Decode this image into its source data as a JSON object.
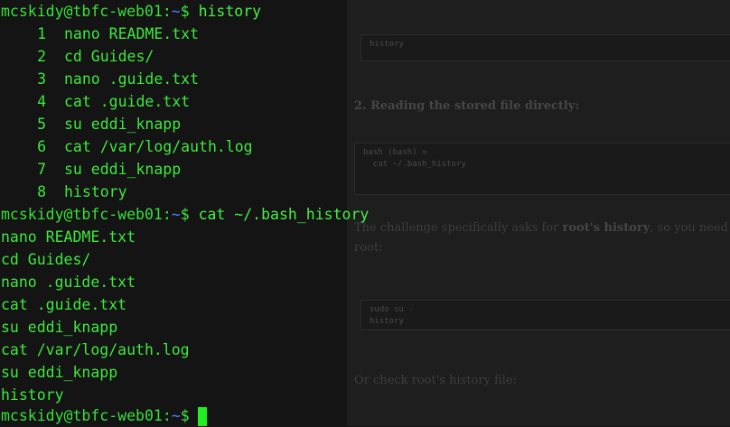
{
  "terminal": {
    "prompt": {
      "user_host": "mcskidy@tbfc-web01",
      "separator": ":",
      "path": "~",
      "symbol": "$"
    },
    "commands": {
      "first": "history",
      "second": "cat ~/.bash_history",
      "third": ""
    },
    "history_entries": [
      {
        "num": "1",
        "cmd": "nano README.txt"
      },
      {
        "num": "2",
        "cmd": "cd Guides/"
      },
      {
        "num": "3",
        "cmd": "nano .guide.txt"
      },
      {
        "num": "4",
        "cmd": "cat .guide.txt"
      },
      {
        "num": "5",
        "cmd": "su eddi_knapp"
      },
      {
        "num": "6",
        "cmd": "cat /var/log/auth.log"
      },
      {
        "num": "7",
        "cmd": "su eddi_knapp"
      },
      {
        "num": "8",
        "cmd": "history"
      }
    ],
    "bash_history_lines": [
      "nano README.txt",
      "cd Guides/",
      "nano .guide.txt",
      "cat .guide.txt",
      "su eddi_knapp",
      "cat /var/log/auth.log",
      "su eddi_knapp",
      "history"
    ],
    "colors": {
      "text": "#3ee83e",
      "path": "#4b80ff",
      "cursor": "#22ee22",
      "background": "#141414"
    }
  },
  "document": {
    "code_block_1": "history",
    "heading_2": "2. Reading the stored file directly:",
    "code_block_2_line1": "bash (bash) =",
    "code_block_2_line2": "cat ~/.bash_history",
    "para_challenge_prefix": "The challenge specifically asks for ",
    "para_challenge_bold": "root's history",
    "para_challenge_suffix": ", so you need to sw",
    "para_challenge_line2": "root:",
    "code_block_3_line1": "sudo su -",
    "code_block_3_line2": "history",
    "para_check": "Or check root's history file:"
  }
}
